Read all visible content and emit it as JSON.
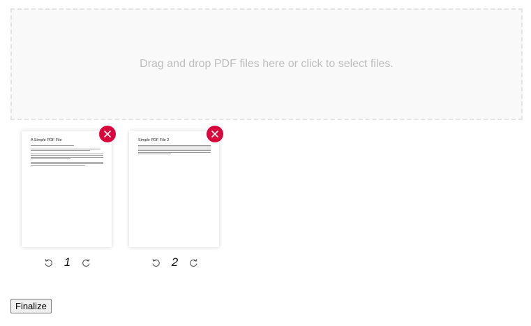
{
  "dropzone": {
    "text": "Drag and drop PDF files here or click to select files."
  },
  "pages": [
    {
      "title": "A Simple PDF File",
      "page_number": "1",
      "remove_icon": "close-icon",
      "rotate_left_icon": "rotate-left-icon",
      "rotate_right_icon": "rotate-right-icon"
    },
    {
      "title": "Simple PDF File 2",
      "page_number": "2",
      "remove_icon": "close-icon",
      "rotate_left_icon": "rotate-left-icon",
      "rotate_right_icon": "rotate-right-icon"
    }
  ],
  "actions": {
    "finalize_label": "Finalize"
  },
  "colors": {
    "remove_button": "#d9073b",
    "dropzone_border": "#e3e3e3",
    "dropzone_text": "#bdbdbd"
  }
}
